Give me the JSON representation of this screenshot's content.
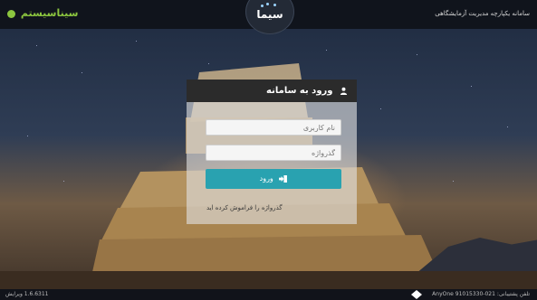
{
  "topbar": {
    "brand": "سیناسیستم",
    "app_title": "سامانه یکپارچه مدیریت آزمایشگاهی",
    "logo_text": "سیما"
  },
  "login": {
    "header": "ورود به سامانه",
    "username_placeholder": "نام کاربری",
    "password_placeholder": "گذرواژه",
    "submit_label": "ورود",
    "forgot_link": "گذرواژه را فراموش کرده اید"
  },
  "footer": {
    "version": "1.6.6311 ویرایش",
    "support": "تلفن پشتیبانی: 021-91015330",
    "company": "AnyOne"
  },
  "colors": {
    "accent": "#29a2b0",
    "brand": "#8cc63f",
    "header_bg": "#2b2b2b"
  },
  "icons": {
    "header": "user-icon",
    "button": "sign-in-icon"
  }
}
